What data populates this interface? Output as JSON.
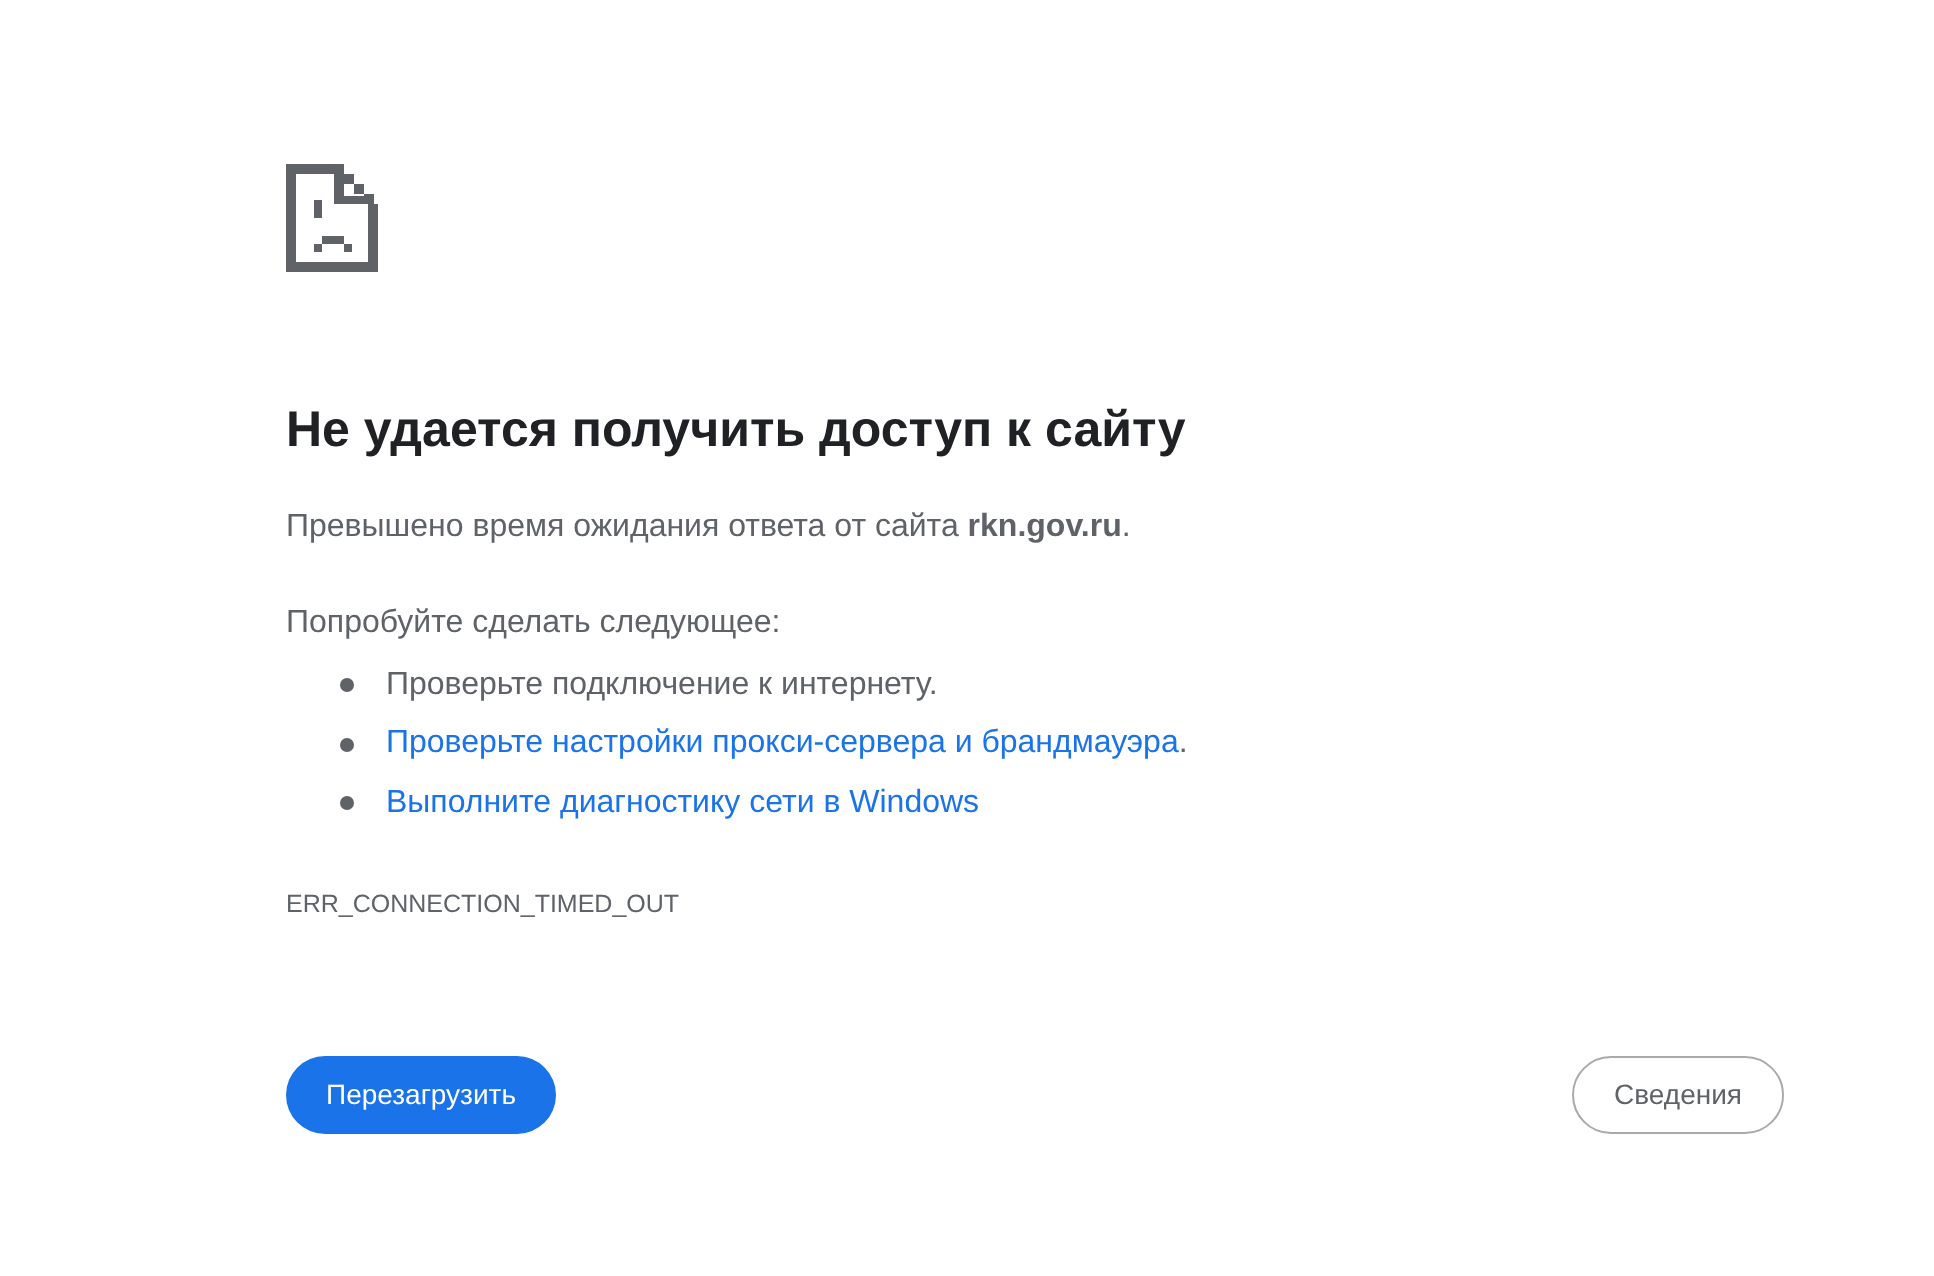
{
  "heading": "Не удается получить доступ к сайту",
  "message": "Превышено время ожидания ответа от сайта **rkn.gov.ru**.",
  "suggestions_intro": "Попробуйте сделать следующее:",
  "suggestions": [
    {
      "kind": "text",
      "text": "Проверьте подключение к интернету."
    },
    {
      "kind": "link",
      "text": "Проверьте настройки прокси-сервера и брандмауэра",
      "suffix": "."
    },
    {
      "kind": "link",
      "text": "Выполните диагностику сети в Windows"
    }
  ],
  "error_code": "ERR_CONNECTION_TIMED_OUT",
  "buttons": {
    "reload": "Перезагрузить",
    "details": "Сведения"
  }
}
